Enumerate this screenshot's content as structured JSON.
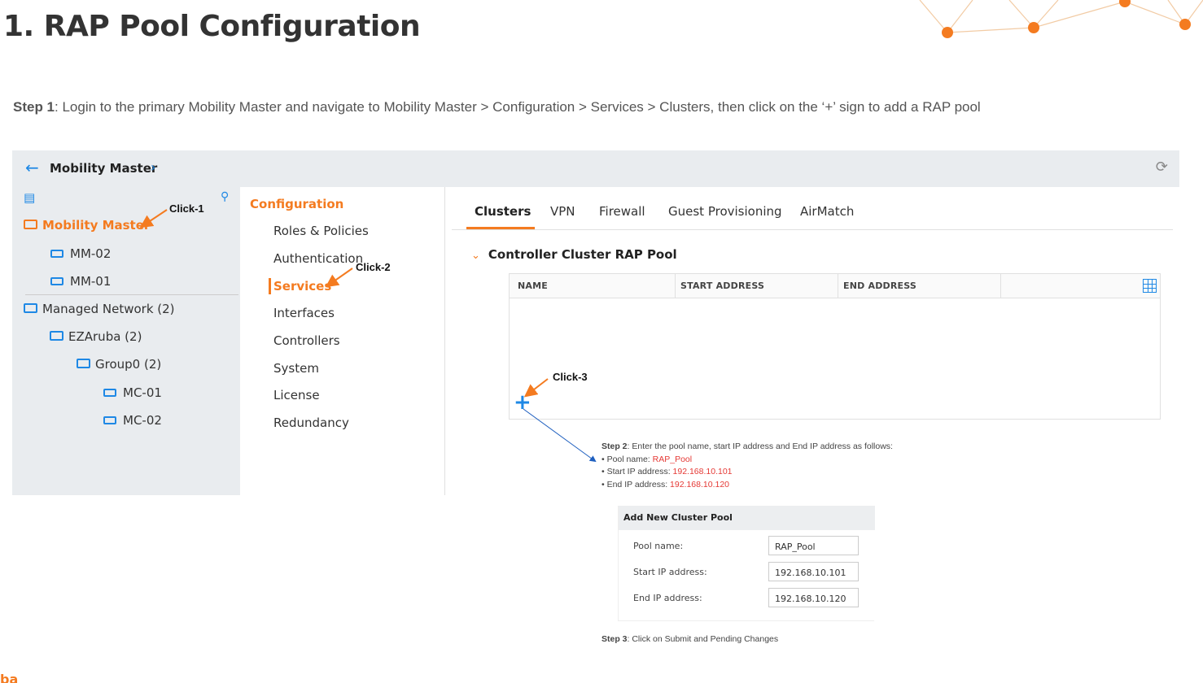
{
  "slide": {
    "title": "1. RAP Pool Configuration",
    "step1_label": "Step 1",
    "step1_text": ": Login to the primary Mobility Master and navigate to Mobility Master > Configuration > Services > Clusters, then click on the ‘+’ sign to add a RAP pool"
  },
  "topbar": {
    "back_icon": "arrow-left-icon",
    "title": "Mobility Master",
    "chevron": "›",
    "refresh_icon": "refresh-icon"
  },
  "sidebar": {
    "items": [
      {
        "label": "Mobility Master",
        "icon": "folder-open-icon",
        "active": true
      },
      {
        "label": "MM-02",
        "icon": "device-icon"
      },
      {
        "label": "MM-01",
        "icon": "device-icon"
      },
      {
        "label": "Managed Network (2)",
        "icon": "folder-open-icon"
      },
      {
        "label": "EZAruba (2)",
        "icon": "folder-open-icon"
      },
      {
        "label": "Group0 (2)",
        "icon": "folder-open-icon"
      },
      {
        "label": "MC-01",
        "icon": "device-icon"
      },
      {
        "label": "MC-02",
        "icon": "device-icon"
      }
    ]
  },
  "config_menu": {
    "heading": "Configuration",
    "items": [
      "Roles & Policies",
      "Authentication",
      "Services",
      "Interfaces",
      "Controllers",
      "System",
      "License",
      "Redundancy"
    ],
    "active": "Services"
  },
  "tabs": [
    "Clusters",
    "VPN",
    "Firewall",
    "Guest Provisioning",
    "AirMatch"
  ],
  "active_tab": "Clusters",
  "section": {
    "title": "Controller Cluster RAP Pool",
    "columns": [
      "NAME",
      "START ADDRESS",
      "END ADDRESS"
    ]
  },
  "callouts": {
    "click1": "Click-1",
    "click2": "Click-2",
    "click3": "Click-3"
  },
  "step2": {
    "label": "Step 2",
    "text": ": Enter the pool name, start IP address and End IP address as follows:",
    "pool_label": "• Pool name: ",
    "pool_value": "RAP_Pool",
    "start_label": "• Start IP address: ",
    "start_value": "192.168.10.101",
    "end_label": "• End IP address: ",
    "end_value": "192.168.10.120"
  },
  "dialog": {
    "title": "Add New Cluster Pool",
    "fields": [
      {
        "label": "Pool name:",
        "value": "RAP_Pool"
      },
      {
        "label": "Start IP address:",
        "value": "192.168.10.101"
      },
      {
        "label": "End IP address:",
        "value": "192.168.10.120"
      }
    ]
  },
  "step3": {
    "label": "Step 3",
    "text": ": Click on Submit and Pending Changes"
  },
  "footer_logo_fragment": "ba",
  "colors": {
    "accent_orange": "#f47b20",
    "link_blue": "#1e88e5",
    "highlight_red": "#e53935",
    "panel_gray": "#e9ecef"
  }
}
